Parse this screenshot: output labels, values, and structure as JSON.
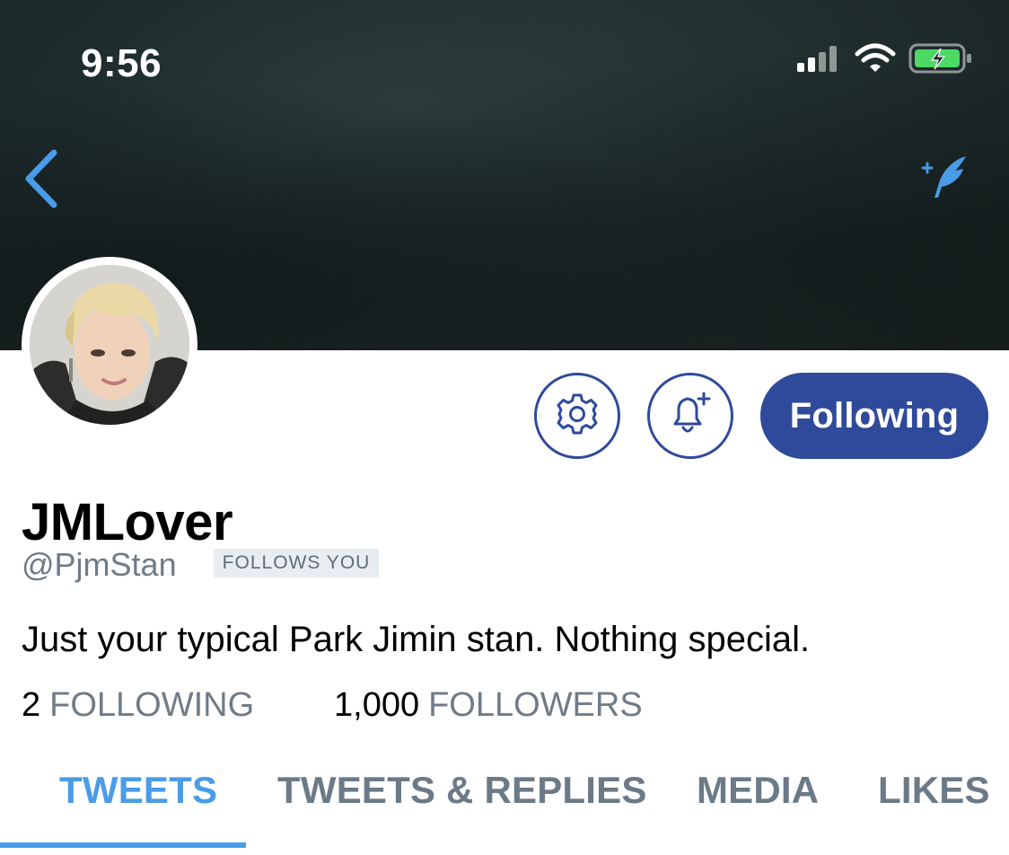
{
  "status_bar": {
    "time": "9:56"
  },
  "profile": {
    "display_name": "JMLover",
    "handle": "@PjmStan",
    "follows_you_badge": "FOLLOWS YOU",
    "bio": "Just your typical Park Jimin stan. Nothing special.",
    "following_count": "2",
    "following_label": "FOLLOWING",
    "followers_count": "1,000",
    "followers_label": "FOLLOWERS"
  },
  "actions": {
    "following_button": "Following"
  },
  "tabs": [
    {
      "label": "TWEETS",
      "active": true
    },
    {
      "label": "TWEETS & REPLIES",
      "active": false
    },
    {
      "label": "MEDIA",
      "active": false
    },
    {
      "label": "LIKES",
      "active": false
    }
  ],
  "colors": {
    "accent": "#4a9ce8",
    "button_blue": "#2f4a9a",
    "secondary_text": "#707b86",
    "battery_green": "#4cd964"
  },
  "icons": {
    "back": "chevron-left-icon",
    "compose": "sparkle-feather-icon",
    "settings": "gear-icon",
    "notifications": "bell-plus-icon",
    "signal": "cellular-signal-icon",
    "wifi": "wifi-icon",
    "battery": "battery-charging-icon"
  }
}
